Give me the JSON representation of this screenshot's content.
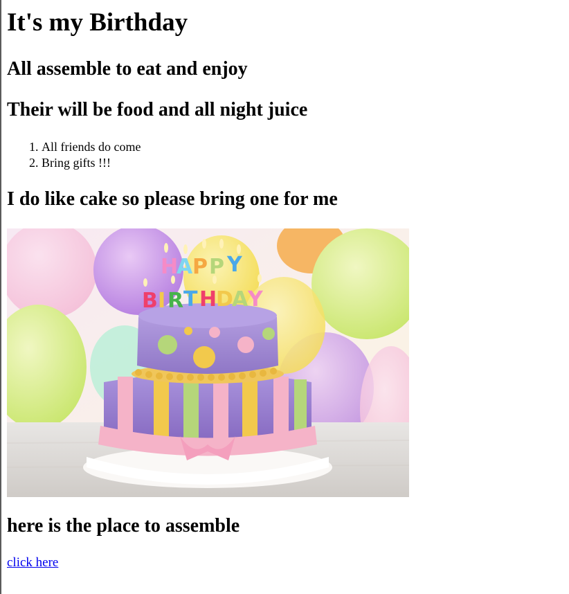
{
  "page": {
    "title": "It's my Birthday",
    "subtitle1": "All assemble to eat and enjoy",
    "subtitle2": "Their will be food and all night juice",
    "list": [
      "All friends do come",
      "Bring gifts !!!"
    ],
    "cake_heading": "I do like cake so please bring one for me",
    "place_heading": "here is the place to assemble",
    "link_label": "click here",
    "cake_image_candles_text": "HAPPY BIRTHDAY"
  },
  "colors": {
    "link": "#0000ee",
    "cake_purple": "#a48fd6",
    "ribbon_pink": "#f5b3c8",
    "stripe_yellow": "#f2c94c",
    "stripe_green": "#b5d67a",
    "plate": "#f3f0ee"
  }
}
